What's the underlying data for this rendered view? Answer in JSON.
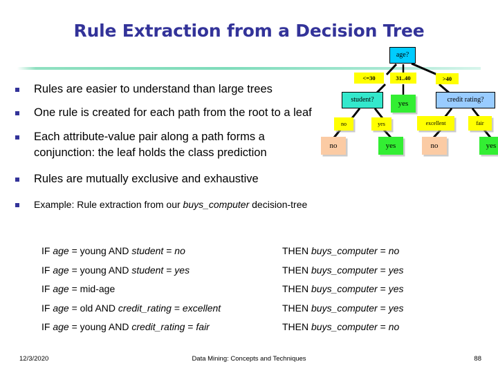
{
  "slide": {
    "title": "Rule Extraction from a Decision Tree",
    "title_color": "#333399",
    "divider_color": "#7fdcbb"
  },
  "bullets": [
    {
      "text": "Rules are easier to understand than large trees",
      "size": "large"
    },
    {
      "text": "One rule is created for each path from the root to a leaf",
      "size": "large"
    },
    {
      "text": "Each attribute-value pair along a path forms a conjunction: the leaf holds the class prediction",
      "size": "large"
    },
    {
      "text": "Rules are mutually exclusive and exhaustive",
      "size": "large"
    },
    {
      "text": "Example: Rule extraction from our buys_computer decision-tree",
      "size": "small",
      "italic_part": "buys_computer"
    }
  ],
  "rules": [
    {
      "if": "IF age = young AND student = no",
      "then": "THEN buys_computer = no"
    },
    {
      "if": "IF age = young AND student = yes",
      "then": "THEN buys_computer = yes"
    },
    {
      "if": "IF age = mid-age",
      "then": "THEN buys_computer = yes"
    },
    {
      "if": "IF age = old AND credit_rating = excellent",
      "then": "THEN buys_computer = yes"
    },
    {
      "if": "IF age = young AND credit_rating = fair",
      "then": "THEN buys_computer = no"
    }
  ],
  "footer": {
    "date": "12/3/2020",
    "center": "Data Mining: Concepts and Techniques",
    "page": "88"
  },
  "tree": {
    "nodes": {
      "root": {
        "label": "age?",
        "color": "#00ccff"
      },
      "edge_le30": {
        "label": "<=30",
        "color": "#ffff00"
      },
      "edge_3140": {
        "label": "31..40",
        "color": "#ffff00"
      },
      "edge_gt40": {
        "label": ">40",
        "color": "#ffff00"
      },
      "student": {
        "label": "student?",
        "color": "#33e8cc"
      },
      "mid_yes": {
        "label": "yes",
        "color": "#33ee33"
      },
      "credit": {
        "label": "credit rating?",
        "color": "#99ccff"
      },
      "edge_no": {
        "label": "no",
        "color": "#ffff00"
      },
      "edge_yes": {
        "label": "yes",
        "color": "#ffff00"
      },
      "edge_excellent": {
        "label": "excellent",
        "color": "#ffff00"
      },
      "edge_fair": {
        "label": "fair",
        "color": "#ffff00"
      },
      "leaf_no_1": {
        "label": "no",
        "color": "#fbcba4"
      },
      "leaf_yes_1": {
        "label": "yes",
        "color": "#33ee33"
      },
      "leaf_no_2": {
        "label": "no",
        "color": "#fbcba4"
      },
      "leaf_yes_2": {
        "label": "yes",
        "color": "#33ee33"
      }
    }
  }
}
